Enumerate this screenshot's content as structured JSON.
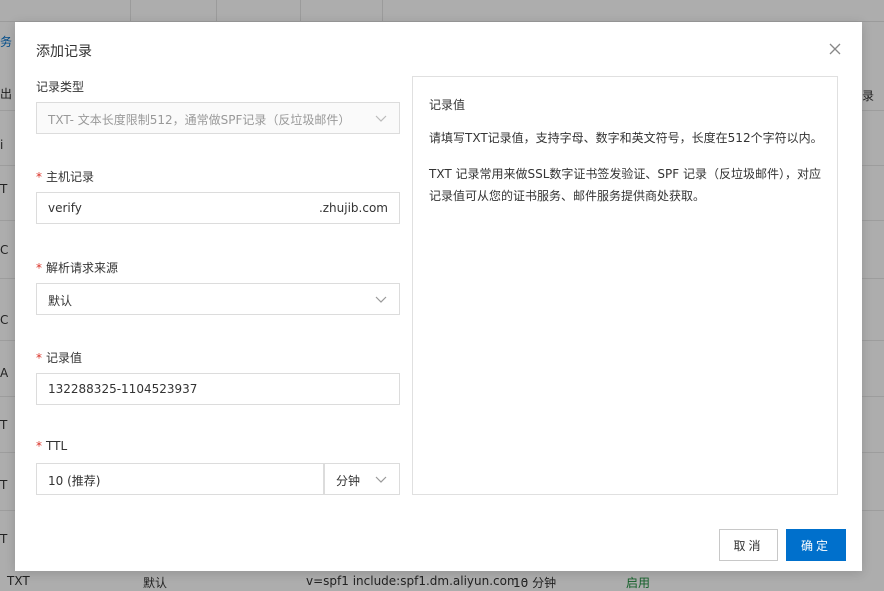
{
  "background": {
    "left_blue_text": "务",
    "left_header_text": "出",
    "left_col_chars": [
      "i",
      "T",
      "C",
      "C",
      "A",
      "T",
      "T",
      "T"
    ],
    "right_header_text": "录",
    "bottom_row": {
      "type": "TXT",
      "line": "默认",
      "value": "v=spf1 include:spf1.dm.aliyun.com -",
      "ttl": "10 分钟",
      "status": "启用"
    }
  },
  "dialog": {
    "title": "添加记录",
    "record_type": {
      "label": "记录类型",
      "value": "TXT- 文本长度限制512，通常做SPF记录（反垃圾邮件）"
    },
    "host": {
      "required": "*",
      "label": "主机记录",
      "value": "verify",
      "suffix": ".zhujib.com"
    },
    "source": {
      "required": "*",
      "label": "解析请求来源",
      "value": "默认"
    },
    "record_value": {
      "required": "*",
      "label": "记录值",
      "value": "132288325-1104523937"
    },
    "ttl": {
      "required": "*",
      "label": "TTL",
      "value": "10 (推荐)",
      "unit": "分钟"
    },
    "info": {
      "title": "记录值",
      "p1": "请填写TXT记录值，支持字母、数字和英文符号，长度在512个字符以内。",
      "p2": "TXT 记录常用来做SSL数字证书签发验证、SPF 记录（反垃圾邮件），对应记录值可从您的证书服务、邮件服务提供商处获取。"
    },
    "buttons": {
      "cancel": "取消",
      "ok": "确定"
    }
  },
  "colors": {
    "primary": "#0070cc",
    "required": "#d93026",
    "status_green": "#1e8e3e"
  }
}
